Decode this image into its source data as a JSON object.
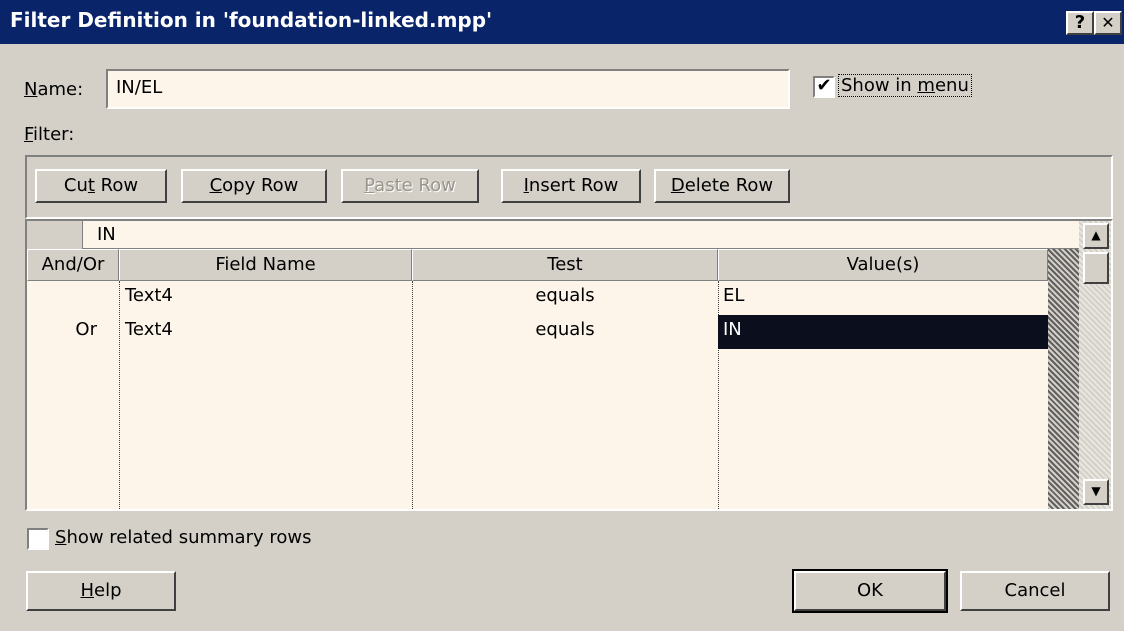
{
  "window": {
    "title": "Filter Definition in 'foundation-linked.mpp'",
    "help_btn": "?",
    "close_btn": "✕"
  },
  "name_row": {
    "label_u": "N",
    "label_rest": "ame:",
    "value": "IN/EL"
  },
  "show_in_menu": {
    "checked": true,
    "check_glyph": "✔",
    "label_pre": "Show in ",
    "label_u": "m",
    "label_post": "enu"
  },
  "filter_label": {
    "u": "F",
    "rest": "ilter:"
  },
  "toolbar": {
    "cut": {
      "pre": "Cu",
      "u": "t",
      "post": " Row"
    },
    "copy": {
      "pre": "",
      "u": "C",
      "post": "opy Row"
    },
    "paste": {
      "pre": "",
      "u": "P",
      "post": "aste Row"
    },
    "insert": {
      "pre": "",
      "u": "I",
      "post": "nsert Row"
    },
    "delete": {
      "pre": "",
      "u": "D",
      "post": "elete Row"
    }
  },
  "grid": {
    "edit_value": "IN",
    "headers": [
      "And/Or",
      "Field Name",
      "Test",
      "Value(s)"
    ],
    "rows": [
      {
        "andor": "",
        "field": "Text4",
        "test": "equals",
        "value": "EL"
      },
      {
        "andor": "Or",
        "field": "Text4",
        "test": "equals",
        "value": "IN"
      }
    ],
    "selected_row": 1
  },
  "scroll": {
    "up": "▲",
    "down": "▼"
  },
  "summary_rows": {
    "checked": false,
    "label_u": "S",
    "label_rest": "how related summary rows"
  },
  "buttons": {
    "help": {
      "u": "H",
      "rest": "elp"
    },
    "ok": "OK",
    "cancel": "Cancel"
  }
}
